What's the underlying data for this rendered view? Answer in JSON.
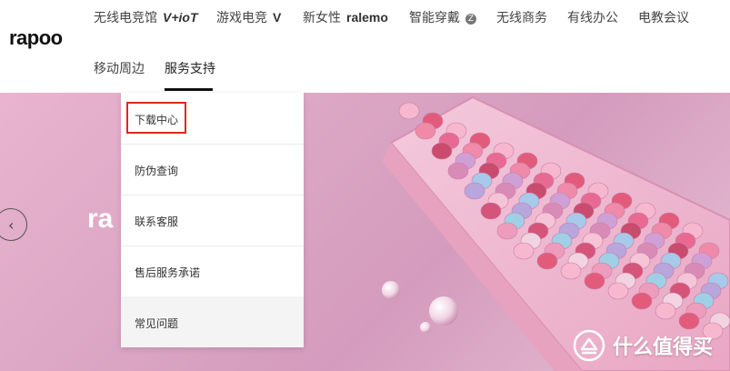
{
  "brand": {
    "logo": "rapoo"
  },
  "nav": {
    "items": [
      {
        "label": "无线电竞馆",
        "suffix": "V+ioT"
      },
      {
        "label": "游戏电竞",
        "suffix": "V"
      },
      {
        "label": "新女性",
        "suffix": "ralemo"
      },
      {
        "label": "智能穿戴",
        "badge": "Z"
      },
      {
        "label": "无线商务"
      },
      {
        "label": "有线办公"
      },
      {
        "label": "电教会议"
      },
      {
        "label": "移动周边"
      },
      {
        "label": "服务支持",
        "active": true
      }
    ]
  },
  "dropdown": {
    "items": [
      {
        "label": "下载中心",
        "highlighted": true
      },
      {
        "label": "防伪查询"
      },
      {
        "label": "联系客服"
      },
      {
        "label": "售后服务承诺"
      },
      {
        "label": "常见问题",
        "hover": true
      }
    ]
  },
  "banner": {
    "brand_text": "ra",
    "prev_arrow": "‹"
  },
  "watermark": {
    "text": "什么值得买"
  },
  "colors": {
    "highlight_box": "#e0271f",
    "banner_pink": "#dba6c4",
    "active_underline": "#111111"
  }
}
